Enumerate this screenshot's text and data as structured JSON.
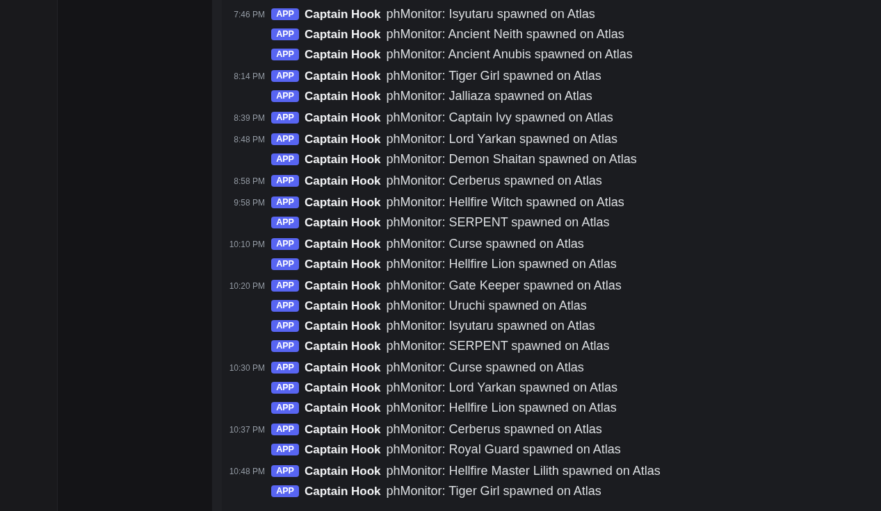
{
  "messages": [
    {
      "time": "7:46 PM",
      "badge": "APP",
      "author": "Captain Hook",
      "text": "phMonitor: Isyutaru spawned on Atlas"
    },
    {
      "badge": "APP",
      "author": "Captain Hook",
      "text": "phMonitor: Ancient Neith spawned on Atlas"
    },
    {
      "badge": "APP",
      "author": "Captain Hook",
      "text": "phMonitor: Ancient Anubis spawned on Atlas"
    },
    {
      "time": "8:14 PM",
      "badge": "APP",
      "author": "Captain Hook",
      "text": "phMonitor: Tiger Girl spawned on Atlas"
    },
    {
      "badge": "APP",
      "author": "Captain Hook",
      "text": "phMonitor: Jalliaza spawned on Atlas"
    },
    {
      "time": "8:39 PM",
      "badge": "APP",
      "author": "Captain Hook",
      "text": "phMonitor: Captain Ivy spawned on Atlas"
    },
    {
      "time": "8:48 PM",
      "badge": "APP",
      "author": "Captain Hook",
      "text": "phMonitor: Lord Yarkan spawned on Atlas"
    },
    {
      "badge": "APP",
      "author": "Captain Hook",
      "text": "phMonitor: Demon Shaitan spawned on Atlas"
    },
    {
      "time": "8:58 PM",
      "badge": "APP",
      "author": "Captain Hook",
      "text": "phMonitor: Cerberus spawned on Atlas"
    },
    {
      "time": "9:58 PM",
      "badge": "APP",
      "author": "Captain Hook",
      "text": "phMonitor: Hellfire Witch spawned on Atlas"
    },
    {
      "badge": "APP",
      "author": "Captain Hook",
      "text": "phMonitor: SERPENT spawned on Atlas"
    },
    {
      "time": "10:10 PM",
      "badge": "APP",
      "author": "Captain Hook",
      "text": "phMonitor: Curse spawned on Atlas"
    },
    {
      "badge": "APP",
      "author": "Captain Hook",
      "text": "phMonitor: Hellfire Lion spawned on Atlas"
    },
    {
      "time": "10:20 PM",
      "badge": "APP",
      "author": "Captain Hook",
      "text": "phMonitor: Gate Keeper spawned on Atlas"
    },
    {
      "badge": "APP",
      "author": "Captain Hook",
      "text": "phMonitor: Uruchi spawned on Atlas"
    },
    {
      "badge": "APP",
      "author": "Captain Hook",
      "text": "phMonitor: Isyutaru spawned on Atlas"
    },
    {
      "badge": "APP",
      "author": "Captain Hook",
      "text": "phMonitor: SERPENT spawned on Atlas"
    },
    {
      "time": "10:30 PM",
      "badge": "APP",
      "author": "Captain Hook",
      "text": "phMonitor: Curse spawned on Atlas"
    },
    {
      "badge": "APP",
      "author": "Captain Hook",
      "text": "phMonitor: Lord Yarkan spawned on Atlas"
    },
    {
      "badge": "APP",
      "author": "Captain Hook",
      "text": "phMonitor: Hellfire Lion spawned on Atlas"
    },
    {
      "time": "10:37 PM",
      "badge": "APP",
      "author": "Captain Hook",
      "text": "phMonitor: Cerberus spawned on Atlas"
    },
    {
      "badge": "APP",
      "author": "Captain Hook",
      "text": "phMonitor: Royal Guard spawned on Atlas"
    },
    {
      "time": "10:48 PM",
      "badge": "APP",
      "author": "Captain Hook",
      "text": "phMonitor: Hellfire Master Lilith spawned on Atlas"
    },
    {
      "badge": "APP",
      "author": "Captain Hook",
      "text": "phMonitor: Tiger Girl spawned on Atlas"
    }
  ]
}
